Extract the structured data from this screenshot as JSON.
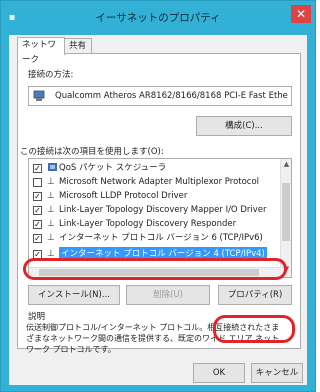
{
  "window": {
    "title": "イーサネットのプロパティ",
    "close_glyph": "✕",
    "sys_icon": "network-icon"
  },
  "tabs": [
    {
      "label": "ネットワーク"
    },
    {
      "label": "共有"
    }
  ],
  "connect_using": {
    "label": "接続の方法:",
    "adapter": "Qualcomm Atheros AR8162/8166/8168 PCI-E Fast Ethe",
    "adapter_icon": "network-adapter-icon"
  },
  "configure_button": "構成(C)...",
  "items_label": "この接続は次の項目を使用します(O):",
  "items": [
    {
      "checked": true,
      "icon": "qos-icon",
      "label": "QoS パケット スケジューラ"
    },
    {
      "checked": false,
      "icon": "protocol-icon",
      "label": "Microsoft Network Adapter Multiplexor Protocol"
    },
    {
      "checked": true,
      "icon": "protocol-icon",
      "label": "Microsoft LLDP Protocol Driver"
    },
    {
      "checked": true,
      "icon": "protocol-icon",
      "label": "Link-Layer Topology Discovery Mapper I/O Driver"
    },
    {
      "checked": true,
      "icon": "protocol-icon",
      "label": "Link-Layer Topology Discovery Responder"
    },
    {
      "checked": true,
      "icon": "protocol-icon",
      "label": "インターネット プロトコル バージョン 6 (TCP/IPv6)"
    },
    {
      "checked": true,
      "icon": "protocol-icon",
      "label": "インターネット プロトコル バージョン 4 (TCP/IPv4)",
      "selected": true
    }
  ],
  "buttons": {
    "install": "インストール(N)...",
    "uninstall": "削除(U)",
    "properties": "プロパティ(R)"
  },
  "description": {
    "label": "説明",
    "text": "伝送制御プロトコル/インターネット プロトコル。相互接続されたさまざまなネットワーク間の通信を提供する、既定のワイド エリア ネットワーク プロトコルです。"
  },
  "footer": {
    "ok": "OK",
    "cancel": "キャンセル"
  },
  "colors": {
    "titlebar": "#33b0d6",
    "close": "#e04343",
    "selection": "#3399ff",
    "highlight": "#e0242a"
  }
}
